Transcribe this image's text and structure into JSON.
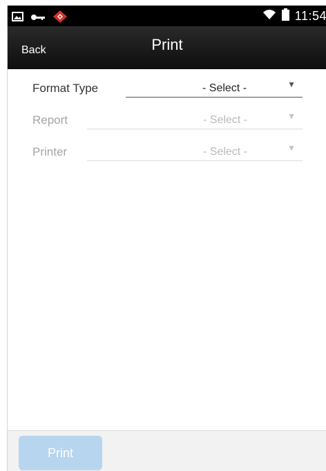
{
  "status_bar": {
    "icons": [
      "picture-icon",
      "key-icon",
      "app-alert-icon",
      "wifi-icon",
      "battery-icon"
    ],
    "time": "11:54"
  },
  "header": {
    "back_label": "Back",
    "title": "Print"
  },
  "form": {
    "fields": [
      {
        "label": "Format Type",
        "value": "- Select -",
        "enabled": true
      },
      {
        "label": "Report",
        "value": "- Select -",
        "enabled": false
      },
      {
        "label": "Printer",
        "value": "- Select -",
        "enabled": false
      }
    ]
  },
  "footer": {
    "print_label": "Print",
    "print_enabled": false
  },
  "colors": {
    "header_bg": "#000000",
    "disabled_button": "#b7d5ef",
    "alert_icon": "#d1322a"
  }
}
